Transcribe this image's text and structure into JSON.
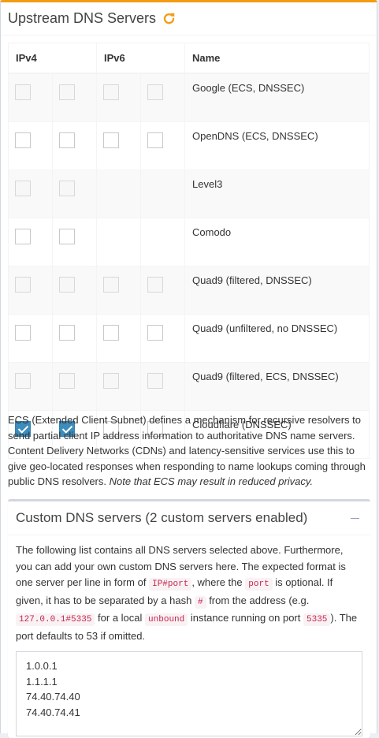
{
  "header": {
    "title": "Upstream DNS Servers",
    "refresh_icon": "refresh-icon",
    "accent_color": "#f39c12"
  },
  "table": {
    "columns": [
      "IPv4",
      "IPv6",
      "Name"
    ],
    "rows": [
      {
        "name": "Google (ECS, DNSSEC)",
        "ipv4": [
          false,
          false
        ],
        "ipv6": [
          false,
          false
        ]
      },
      {
        "name": "OpenDNS (ECS, DNSSEC)",
        "ipv4": [
          false,
          false
        ],
        "ipv6": [
          false,
          false
        ]
      },
      {
        "name": "Level3",
        "ipv4": [
          false,
          false
        ],
        "ipv6": []
      },
      {
        "name": "Comodo",
        "ipv4": [
          false,
          false
        ],
        "ipv6": []
      },
      {
        "name": "Quad9 (filtered, DNSSEC)",
        "ipv4": [
          false,
          false
        ],
        "ipv6": [
          false,
          false
        ]
      },
      {
        "name": "Quad9 (unfiltered, no DNSSEC)",
        "ipv4": [
          false,
          false
        ],
        "ipv6": [
          false,
          false
        ]
      },
      {
        "name": "Quad9 (filtered, ECS, DNSSEC)",
        "ipv4": [
          false,
          false
        ],
        "ipv6": [
          false,
          false
        ]
      },
      {
        "name": "Cloudflare (DNSSEC)",
        "ipv4": [
          true,
          true
        ],
        "ipv6": [
          false,
          false
        ]
      }
    ],
    "checked_color": "#3c8dbc"
  },
  "ecs": {
    "text": "ECS (Extended Client Subnet) defines a mechanism for recursive resolvers to send partial client IP address information to authoritative DNS name servers. Content Delivery Networks (CDNs) and latency-sensitive services use this to give geo-located responses when responding to name lookups coming through public DNS resolvers.",
    "note": "Note that ECS may result in reduced privacy."
  },
  "custom": {
    "title": "Custom DNS servers (2 custom servers enabled)",
    "collapse_icon": "minus-icon",
    "desc_1": "The following list contains all DNS servers selected above. Furthermore, you can add your own custom DNS servers here. The expected format is one server per line in form of",
    "code_ipport": "IP#port",
    "desc_2": ", where the",
    "code_port": "port",
    "desc_3": "is optional. If given, it has to be separated by a hash",
    "code_hash": "#",
    "desc_4": "from the address (e.g.",
    "code_example": "127.0.0.1#5335",
    "desc_5": "for a local",
    "code_unbound": "unbound",
    "desc_6": "instance running on port",
    "code_5335": "5335",
    "desc_7": "). The port defaults to 53 if omitted.",
    "servers": "1.0.0.1\n1.1.1.1\n74.40.74.40\n74.40.74.41"
  }
}
